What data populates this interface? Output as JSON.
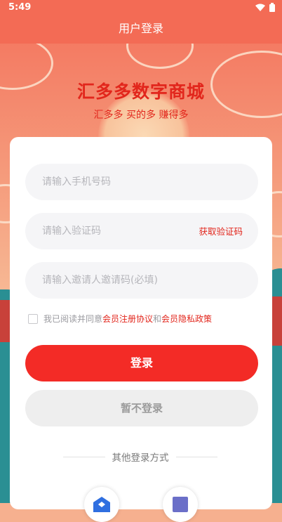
{
  "status_bar": {
    "time": "5:49",
    "wifi_icon": "wifi-icon",
    "battery_icon": "battery-icon"
  },
  "header": {
    "title": "用户登录"
  },
  "brand": {
    "title": "汇多多数字商城",
    "subtitle": "汇多多 买的多 赚得多"
  },
  "form": {
    "phone": {
      "placeholder": "请输入手机号码"
    },
    "code": {
      "placeholder": "请输入验证码",
      "action_label": "获取验证码"
    },
    "invite": {
      "placeholder": "请输入邀请人邀请码(必填)"
    },
    "agreement": {
      "prefix": "我已阅读并同意",
      "terms_link": "会员注册协议",
      "and": "和",
      "privacy_link": "会员隐私政策"
    },
    "login_button": "登录",
    "skip_button": "暂不登录"
  },
  "other_login": {
    "label": "其他登录方式",
    "icons": [
      "shield-login-icon",
      "square-login-icon"
    ]
  },
  "colors": {
    "header": "#f36b55",
    "accent": "#e2261c",
    "login_button": "#f32b26"
  }
}
